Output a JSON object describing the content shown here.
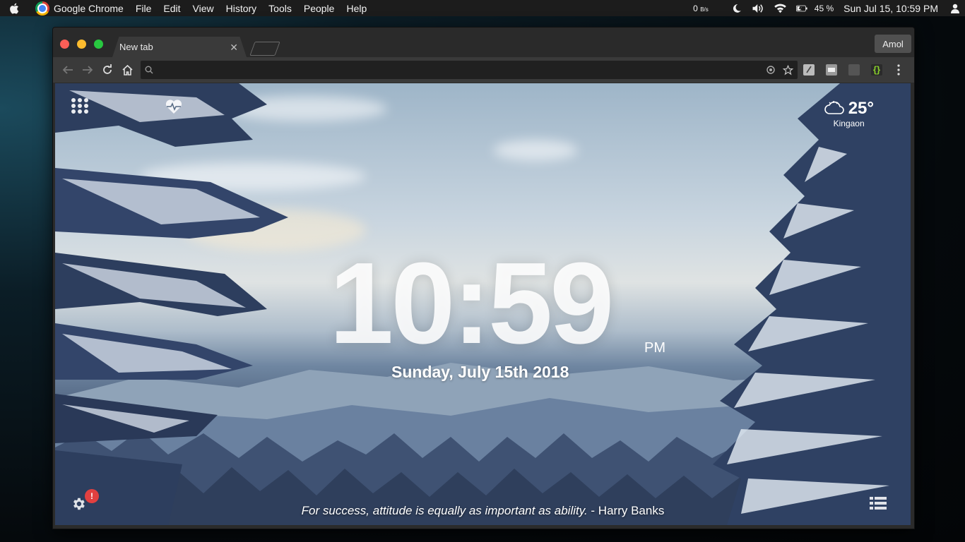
{
  "menubar": {
    "app_name": "Google Chrome",
    "menus": [
      {
        "label": "File"
      },
      {
        "label": "Edit"
      },
      {
        "label": "View"
      },
      {
        "label": "History"
      },
      {
        "label": "Tools"
      },
      {
        "label": "People"
      },
      {
        "label": "Help"
      }
    ],
    "net_speed_value": "0",
    "net_speed_unit": "B/s",
    "battery": "45 %",
    "datetime": "Sun Jul 15, 10:59 PM"
  },
  "browser": {
    "tab_title": "New tab",
    "profile_name": "Amol",
    "omnibox_value": ""
  },
  "newtab": {
    "temperature": "25°",
    "city": "Kingaon",
    "time": "10:59",
    "ampm": "PM",
    "date": "Sunday, July 15th 2018",
    "quote_text": "For success, attitude is equally as important as ability.",
    "quote_author": " - Harry Banks",
    "notification_badge": "!"
  },
  "icons": {
    "menubar": [
      "apple-icon",
      "chrome-logo-icon",
      "moon-icon",
      "volume-icon",
      "wifi-icon",
      "battery-icon",
      "user-icon"
    ],
    "toolbar": [
      "back-icon",
      "forward-icon",
      "reload-icon",
      "home-icon",
      "search-icon",
      "location-icon",
      "star-icon",
      "menu-dots-icon"
    ],
    "newtab": [
      "apps-grid-icon",
      "health-icon",
      "cloud-icon",
      "gear-icon",
      "list-icon"
    ]
  }
}
